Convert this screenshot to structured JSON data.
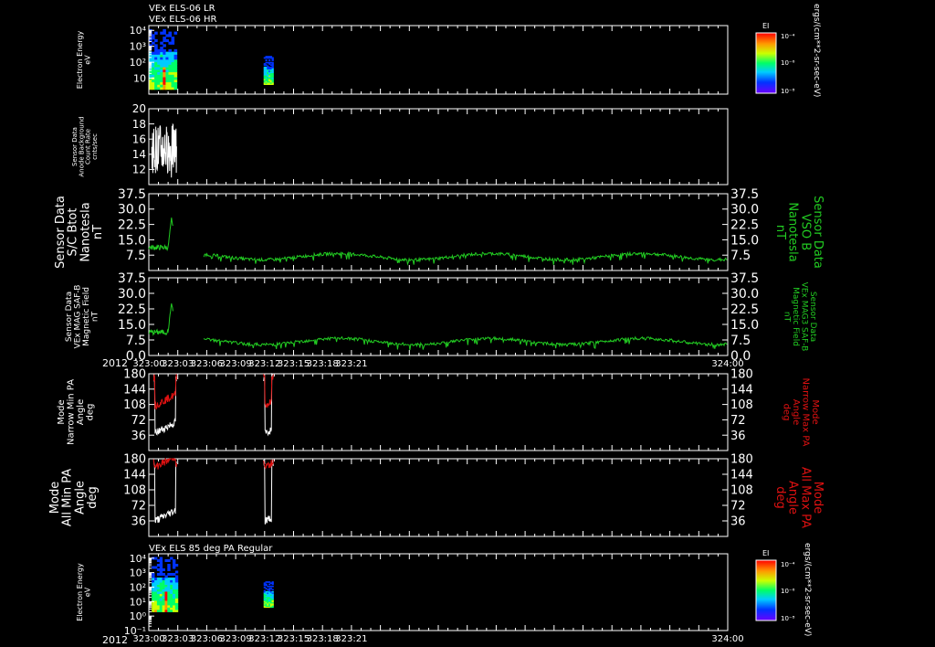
{
  "title_lines": [
    "VEx ELS-06 LR",
    "VEx ELS-06 HR"
  ],
  "year_label": "2012",
  "colors": {
    "background": "#000000",
    "axis": "#ffffff",
    "white_series": "#ffffff",
    "green_series": "#22cc22",
    "red_series": "#dd1111"
  },
  "chart_data": [
    {
      "type": "heatmap",
      "id": "els-lr-hr",
      "title": "VEx ELS-06 LR / VEx ELS-06 HR",
      "ylabel": [
        "Electron Energy",
        "eV"
      ],
      "y_scale": "log",
      "ylim": [
        1,
        20000
      ],
      "y_ticks": [
        "10",
        "10²",
        "10³",
        "10⁴"
      ],
      "xlim": [
        "323:00",
        "324:00"
      ],
      "data_intervals": [
        [
          "323:00",
          "323:02.9"
        ],
        [
          "323:11.9",
          "323:12.9"
        ]
      ],
      "colorbar": {
        "title": "EI",
        "ticks": [
          "10⁻⁴",
          "10⁻⁶",
          "10⁻⁸"
        ],
        "unit": "ergs/(cm**2-sr-sec-eV)"
      }
    },
    {
      "type": "line",
      "id": "anode-background",
      "ylabel": [
        "Sensor Data",
        "Anode Background",
        "Count Rate",
        "cnts/sec"
      ],
      "ylim": [
        10,
        20
      ],
      "y_ticks": [
        12,
        14,
        16,
        18,
        20
      ],
      "xlim": [
        "323:00",
        "324:00"
      ],
      "series": [
        {
          "color": "white",
          "x_range": [
            "323:00.3",
            "323:02.9"
          ],
          "values_range": [
            10.5,
            18.8
          ]
        }
      ]
    },
    {
      "type": "line",
      "id": "sc-btot",
      "ylabel": [
        "Sensor Data",
        "S/C Btot",
        "Nanotesla",
        "nT"
      ],
      "ylabel_right": [
        "Sensor Data",
        "VSO B",
        "Nanotesla",
        "nT"
      ],
      "ylim": [
        0,
        37.5
      ],
      "y_ticks": [
        7.5,
        15.0,
        22.5,
        30.0,
        37.5
      ],
      "xlim": [
        "323:00",
        "324:00"
      ],
      "series": [
        {
          "color": "green",
          "segments": [
            [
              "323:00",
              "323:02.5"
            ],
            [
              "323:05.7",
              "324:00"
            ]
          ],
          "values_range": [
            3,
            25
          ]
        }
      ]
    },
    {
      "type": "line",
      "id": "mag3-saf",
      "ylabel": [
        "Sensor Data",
        "VEx MAG SAF-B",
        "Magnetic Field",
        "nT"
      ],
      "ylabel_right": [
        "Sensor Data",
        "VEx MAG3 SAF-B",
        "Magnetic Field",
        "nT"
      ],
      "ylim": [
        0,
        37.5
      ],
      "y_ticks": [
        0.0,
        7.5,
        15.0,
        22.5,
        30.0,
        37.5
      ],
      "xlim": [
        "323:00",
        "324:00"
      ],
      "x_ticks": [
        "323:00",
        "323:03",
        "323:06",
        "323:09",
        "323:12",
        "323:15",
        "323:18",
        "323:21",
        "324:00"
      ],
      "series": [
        {
          "color": "green",
          "segments": [
            [
              "323:00",
              "323:02.5"
            ],
            [
              "323:05.7",
              "324:00"
            ]
          ],
          "values_range": [
            2,
            25
          ]
        }
      ]
    },
    {
      "type": "line",
      "id": "narrow-pa",
      "ylabel": [
        "Mode",
        "Narrow Min PA",
        "Angle",
        "deg"
      ],
      "ylabel_right": [
        "Mode",
        "Narrow Max PA",
        "Angle",
        "deg"
      ],
      "ylim": [
        0,
        180
      ],
      "y_ticks": [
        36,
        72,
        108,
        144,
        180
      ],
      "xlim": [
        "323:00",
        "324:00"
      ],
      "series": [
        {
          "color": "white",
          "segments": [
            [
              "323:00.5",
              "323:02.9"
            ],
            [
              "323:11.9",
              "323:12.9"
            ]
          ],
          "values_range": [
            8,
            180
          ]
        },
        {
          "color": "red",
          "segments": [
            [
              "323:00.5",
              "323:02.9"
            ],
            [
              "323:11.9",
              "323:12.9"
            ]
          ],
          "values_range": [
            60,
            180
          ]
        }
      ]
    },
    {
      "type": "line",
      "id": "all-pa",
      "ylabel": [
        "Mode",
        "All Min PA",
        "Angle",
        "deg"
      ],
      "ylabel_right": [
        "Mode",
        "All Max PA",
        "Angle",
        "deg"
      ],
      "ylim": [
        0,
        180
      ],
      "y_ticks": [
        36,
        72,
        108,
        144,
        180
      ],
      "xlim": [
        "323:00",
        "324:00"
      ],
      "series": [
        {
          "color": "white",
          "segments": [
            [
              "323:00.5",
              "323:02.9"
            ],
            [
              "323:11.9",
              "323:12.9"
            ]
          ],
          "values_range": [
            5,
            180
          ]
        },
        {
          "color": "red",
          "segments": [
            [
              "323:00.5",
              "323:02.9"
            ],
            [
              "323:11.9",
              "323:12.9"
            ]
          ],
          "values_range": [
            110,
            180
          ]
        }
      ]
    },
    {
      "type": "heatmap",
      "id": "els-85deg",
      "title": "VEx ELS 85 deg PA Regular",
      "ylabel": [
        "Electron Energy",
        "eV"
      ],
      "y_scale": "log",
      "ylim": [
        0.1,
        20000
      ],
      "y_ticks": [
        "10⁻¹",
        "10⁰",
        "10¹",
        "10²",
        "10³",
        "10⁴"
      ],
      "xlim": [
        "323:00",
        "324:00"
      ],
      "x_ticks": [
        "323:00",
        "323:03",
        "323:06",
        "323:09",
        "323:12",
        "323:15",
        "323:18",
        "323:21",
        "324:00"
      ],
      "data_intervals": [
        [
          "323:00.3",
          "323:03"
        ],
        [
          "323:11.9",
          "323:12.9"
        ]
      ],
      "colorbar": {
        "title": "EI",
        "ticks": [
          "10⁻⁴",
          "10⁻⁶",
          "10⁻⁸"
        ],
        "unit": "ergs/(cm**2-sr-sec-eV)"
      }
    }
  ]
}
